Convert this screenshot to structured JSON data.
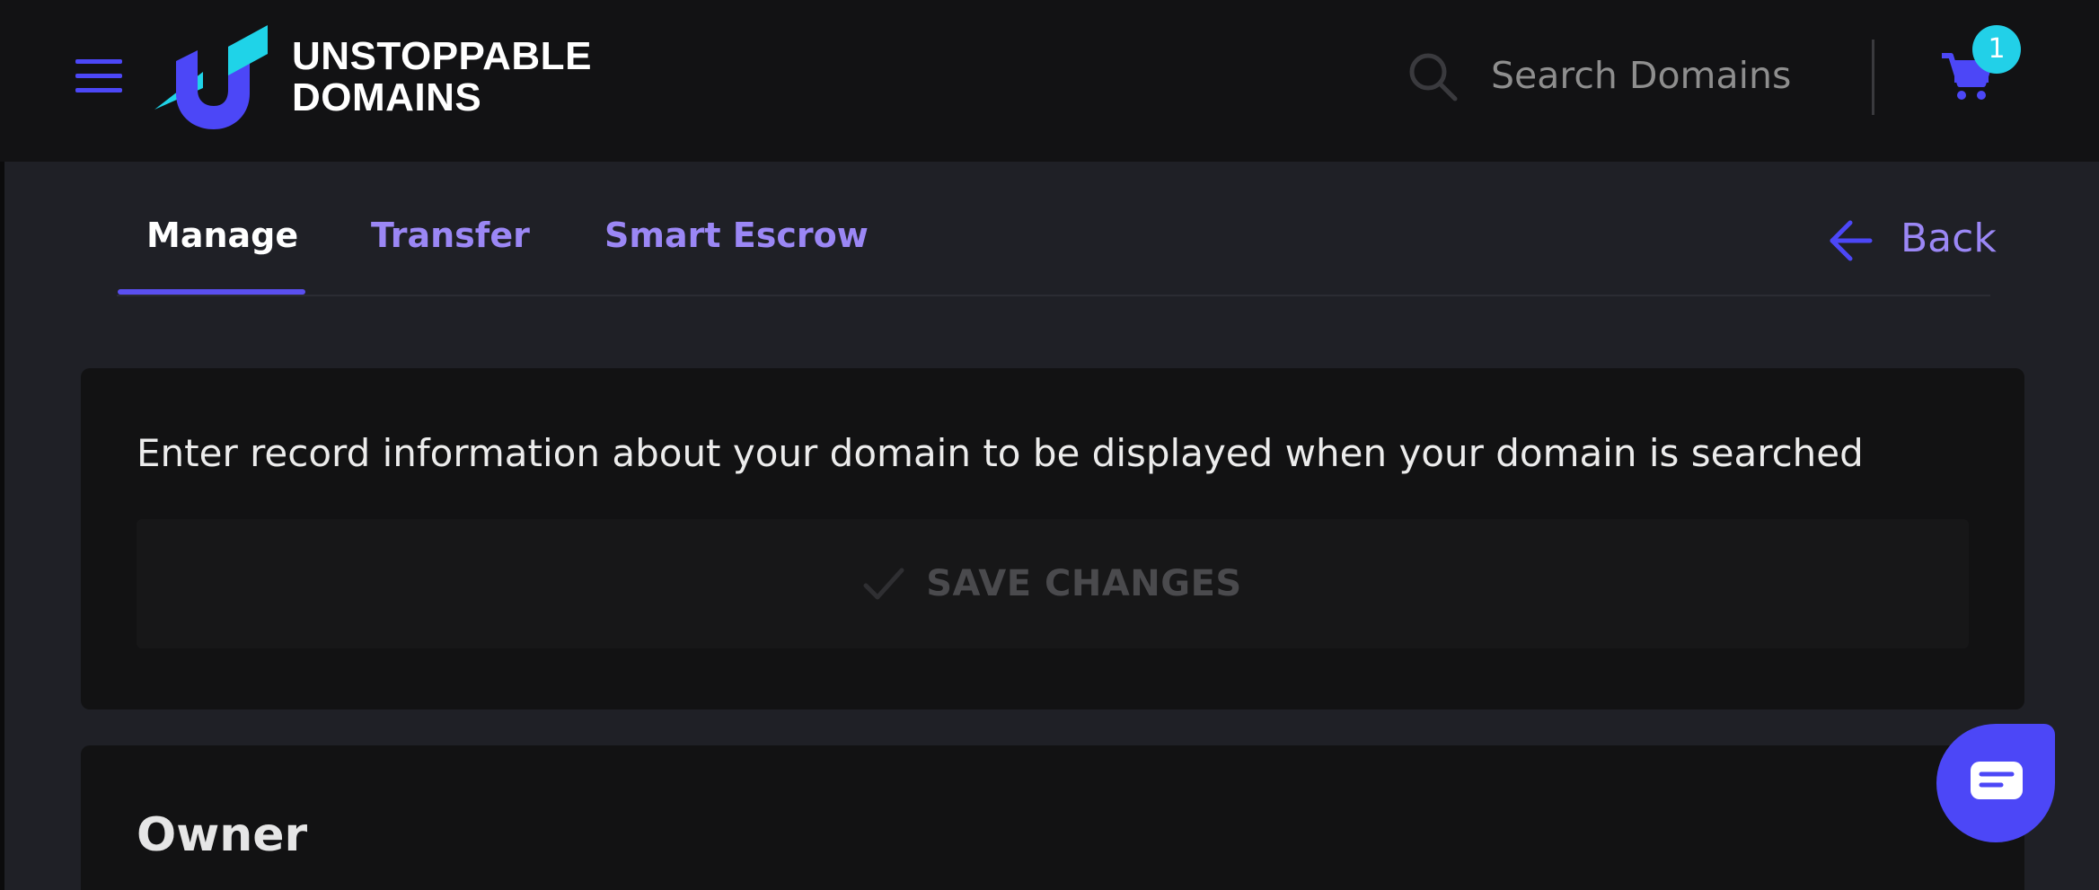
{
  "header": {
    "brand_line1": "UNSTOPPABLE",
    "brand_line2": "DOMAINS",
    "search_placeholder": "Search Domains",
    "cart_count": "1"
  },
  "tabs": [
    {
      "label": "Manage",
      "active": true
    },
    {
      "label": "Transfer",
      "active": false
    },
    {
      "label": "Smart Escrow",
      "active": false
    }
  ],
  "back_label": "Back",
  "records": {
    "description": "Enter record information about your domain to be displayed when your domain is searched",
    "save_label": "SAVE CHANGES"
  },
  "owner": {
    "title": "Owner"
  },
  "icons": {
    "menu": "hamburger-menu-icon",
    "search": "search-icon",
    "cart": "shopping-cart-icon",
    "back": "arrow-left-icon",
    "save": "checkmark-icon",
    "chat": "chat-bubble-icon"
  },
  "colors": {
    "accent": "#4c47f7",
    "tab_link": "#9b87f5",
    "badge": "#22d0e8",
    "logo_cyan": "#1fd3e8",
    "background": "#1f2026",
    "header_bg": "#121214",
    "card_bg": "#121213"
  }
}
